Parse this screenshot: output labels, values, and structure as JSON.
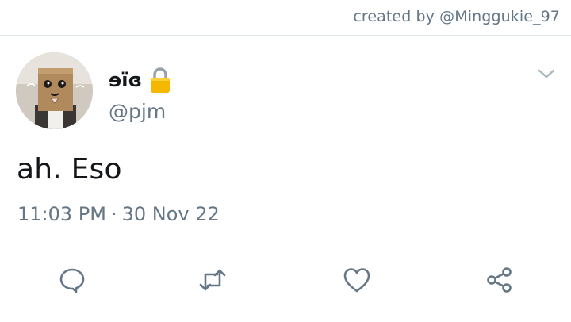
{
  "credit": "created by @Minggukie_97",
  "tweet": {
    "display_name": "ɘïɞ",
    "handle": "@pjm",
    "text": "ah. Eso",
    "time": "11:03 PM",
    "separator": "·",
    "date": "30 Nov 22",
    "verified_lock": true
  },
  "icons": {
    "more": "chevron-down-icon",
    "lock": "lock-icon",
    "reply": "reply-icon",
    "retweet": "retweet-icon",
    "like": "heart-icon",
    "share": "share-icon"
  },
  "colors": {
    "primary_text": "#14171a",
    "secondary_text": "#657786",
    "divider": "#e1e8ed",
    "icon": "#657786",
    "lock_body": "#f5b800"
  }
}
